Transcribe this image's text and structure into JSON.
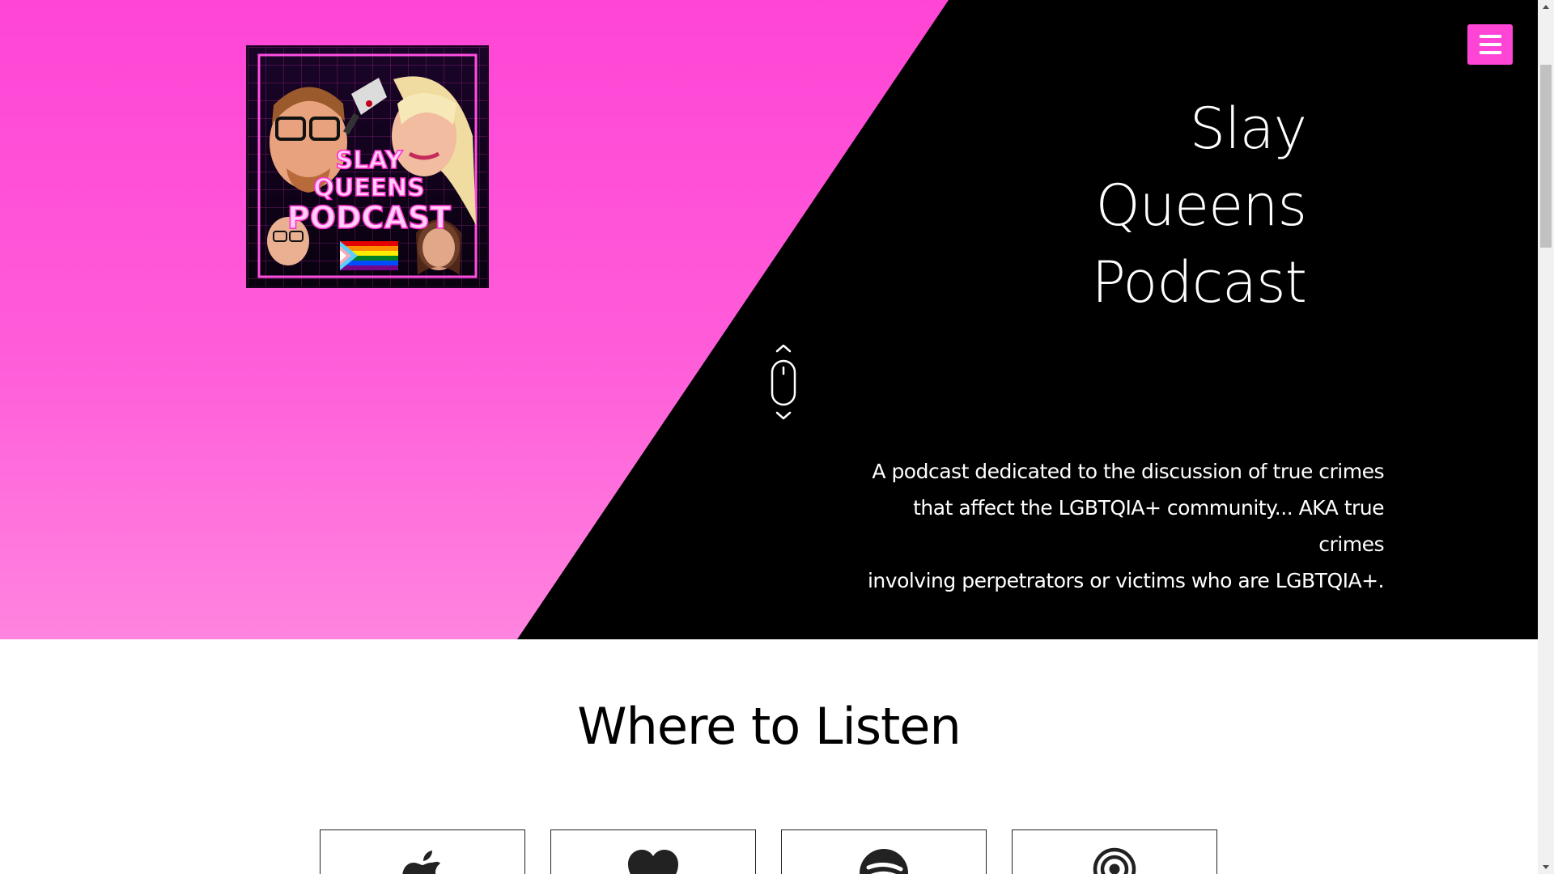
{
  "hero": {
    "title_lines": [
      "Slay",
      "Queens",
      "Podcast"
    ],
    "description_lines": [
      "A podcast dedicated to the discussion of true crimes",
      "that affect the LGBTQIA+ community... AKA true crimes",
      "involving perpetrators or victims who are LGBTQIA+."
    ],
    "cover_art": {
      "text_lines": [
        "SLAY",
        "QUEENS",
        "PODCAST"
      ]
    },
    "menu_icon": "hamburger-menu-icon",
    "scroll_icon": "mouse-scroll-icon"
  },
  "listen": {
    "heading": "Where to Listen",
    "platforms": [
      {
        "icon": "apple-icon"
      },
      {
        "icon": "heart-icon"
      },
      {
        "icon": "spotify-icon"
      },
      {
        "icon": "podcast-icon"
      }
    ]
  },
  "colors": {
    "pink": "#ff45d6",
    "black": "#000000",
    "white": "#ffffff"
  }
}
